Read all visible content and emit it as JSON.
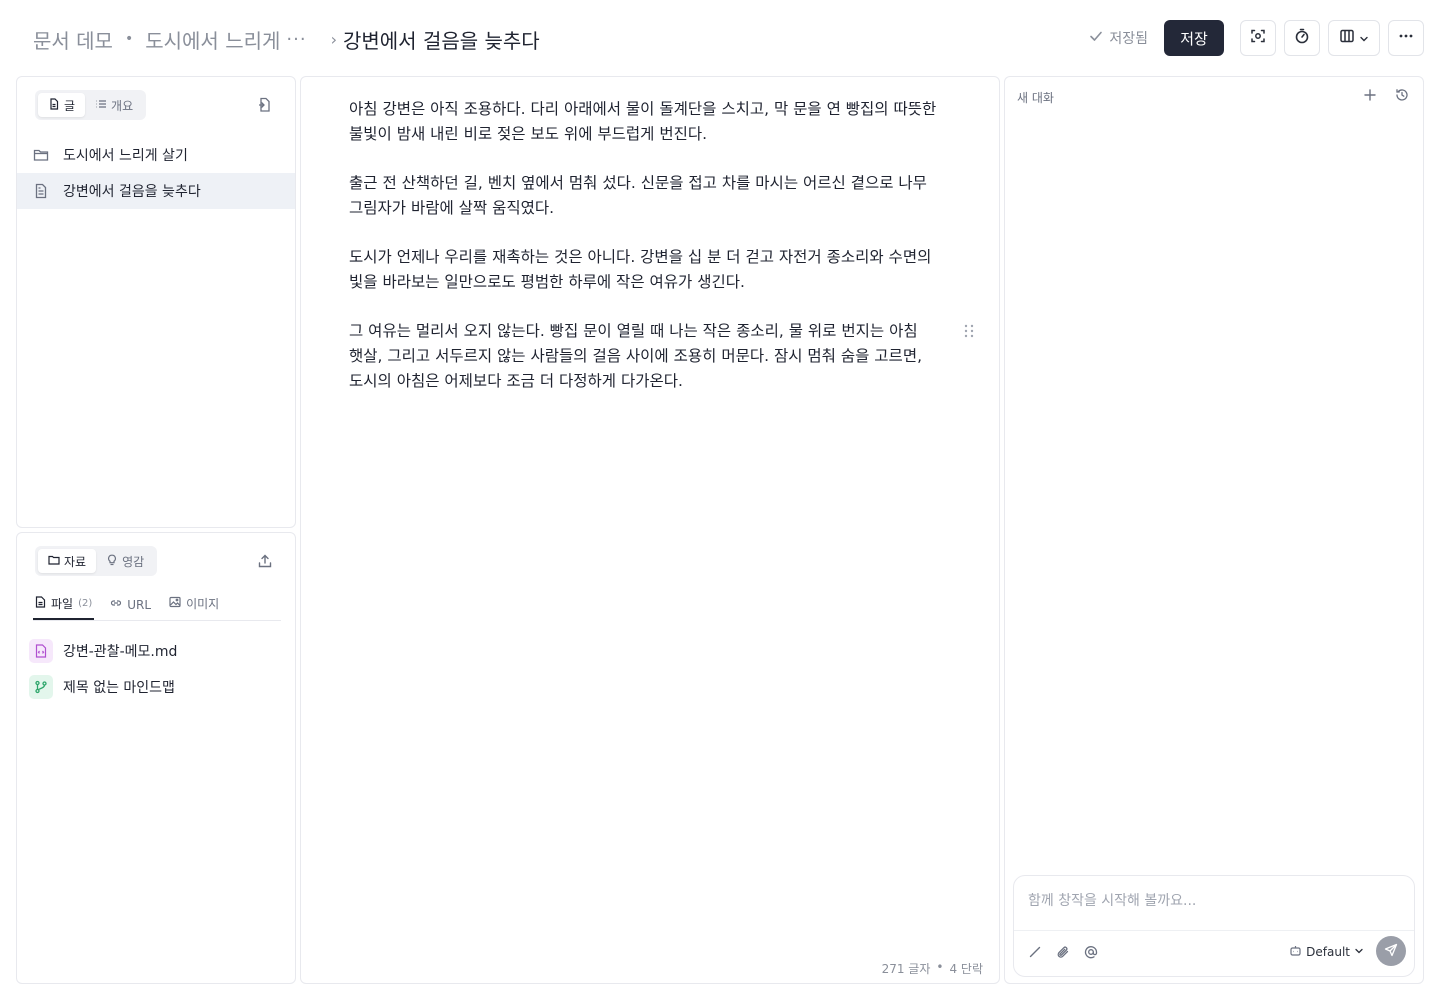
{
  "breadcrumb": {
    "workspace": "문서 데모",
    "folder": "도시에서 느리게",
    "ellipsis": "···",
    "current": "강변에서 걸음을 늦추다"
  },
  "toolbar": {
    "saved_status": "저장됨",
    "save_label": "저장"
  },
  "doc_panel": {
    "tabs": [
      {
        "label": "글",
        "icon": "document-icon",
        "active": true
      },
      {
        "label": "개요",
        "icon": "list-icon",
        "active": false
      }
    ],
    "tree": [
      {
        "label": "도시에서 느리게 살기",
        "icon": "folder-icon",
        "selected": false
      },
      {
        "label": "강변에서 걸음을 늦추다",
        "icon": "document-icon",
        "selected": true
      }
    ]
  },
  "resource_panel": {
    "tabs": [
      {
        "label": "자료",
        "icon": "folder-icon",
        "active": true
      },
      {
        "label": "영감",
        "icon": "lightbulb-icon",
        "active": false
      }
    ],
    "subtabs": [
      {
        "label": "파일",
        "count": "(2)",
        "icon": "file-icon",
        "active": true
      },
      {
        "label": "URL",
        "count": "",
        "icon": "link-icon",
        "active": false
      },
      {
        "label": "이미지",
        "count": "",
        "icon": "image-icon",
        "active": false
      }
    ],
    "items": [
      {
        "label": "강변-관찰-메모.md",
        "icon": "markdown-file-icon",
        "color": "#f6e8fb"
      },
      {
        "label": "제목 없는 마인드맵",
        "icon": "mindmap-icon",
        "color": "#e3f6ec"
      }
    ]
  },
  "editor": {
    "paragraphs": [
      "아침 강변은 아직 조용하다. 다리 아래에서 물이 돌계단을 스치고, 막 문을 연 빵집의 따뜻한 불빛이 밤새 내린 비로 젖은 보도 위에 부드럽게 번진다.",
      "출근 전 산책하던 길, 벤치 옆에서 멈춰 섰다. 신문을 접고 차를 마시는 어르신 곁으로 나무 그림자가 바람에 살짝 움직였다.",
      "도시가 언제나 우리를 재촉하는 것은 아니다. 강변을 십 분 더 걷고 자전거 종소리와 수면의 빛을 바라보는 일만으로도 평범한 하루에 작은 여유가 생긴다.",
      "그 여유는 멀리서 오지 않는다. 빵집 문이 열릴 때 나는 작은 종소리, 물 위로 번지는 아침 햇살, 그리고 서두르지 않는 사람들의 걸음 사이에 조용히 머문다. 잠시 멈춰 숨을 고르면, 도시의 아침은 어제보다 조금 더 다정하게 다가온다."
    ],
    "char_count": "271 글자",
    "paragraph_count": "4 단락",
    "separator": "•"
  },
  "chat": {
    "title": "새 대화",
    "placeholder": "함께 창작을 시작해 볼까요...",
    "model": "Default"
  },
  "colors": {
    "accent": "#232838",
    "selected_row": "#eef1f6",
    "border": "#e8e9ee"
  }
}
